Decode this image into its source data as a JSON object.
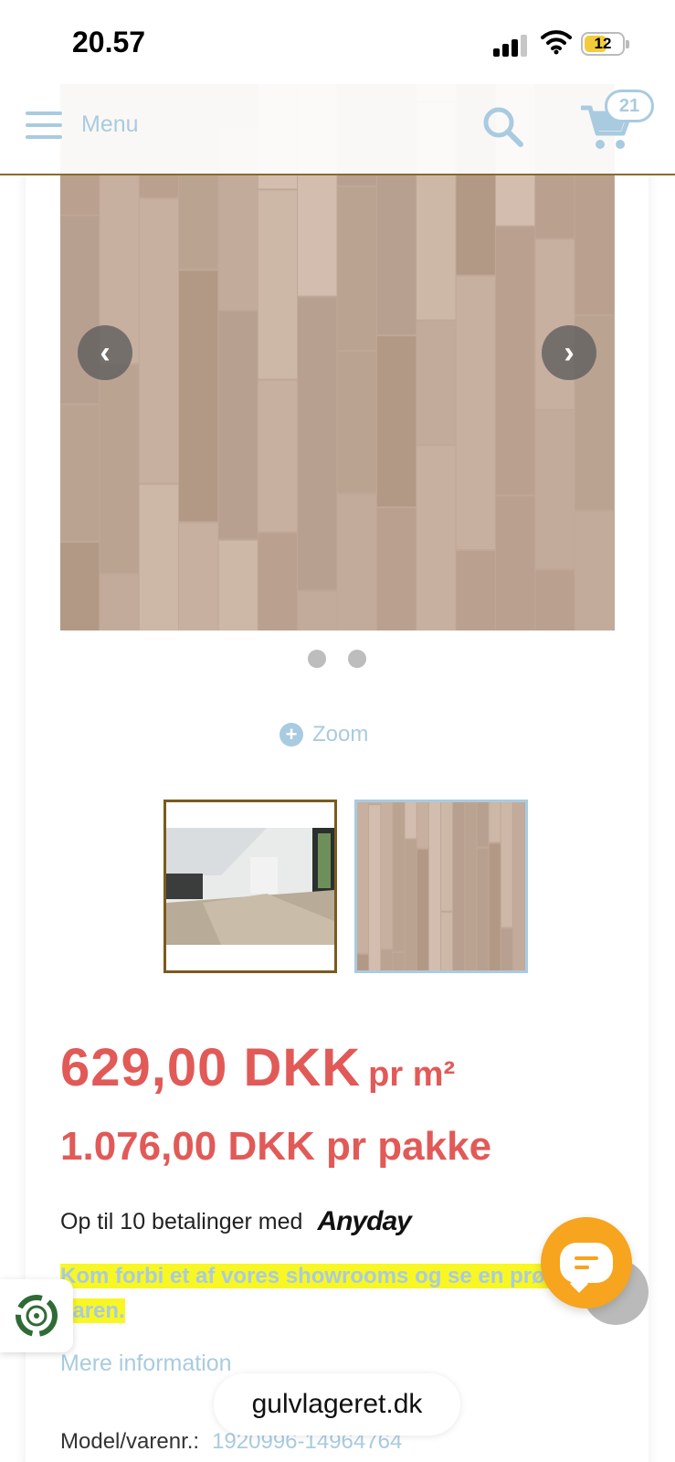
{
  "status_bar": {
    "time": "20.57",
    "battery": "12"
  },
  "header": {
    "menu_label": "Menu",
    "cart_count": "21"
  },
  "gallery": {
    "zoom_label": "Zoom",
    "slide_count": 2
  },
  "pricing": {
    "price_per_m2": "629,00 DKK",
    "unit_m2": "pr m²",
    "price_per_package": "1.076,00 DKK pr pakke"
  },
  "payment": {
    "text": "Op til 10 betalinger med",
    "provider": "Anyday"
  },
  "showroom_notice": "Kom forbi et af vores showrooms og se en prøve på varen.",
  "more_info": "Mere information",
  "model": {
    "label": "Model/varenr.:",
    "value": "1920996-14964764"
  },
  "browser": {
    "url": "gulvlageret.dk"
  },
  "colors": {
    "accent_blue": "#a9cbe0",
    "price_red": "#e15a57",
    "chat_orange": "#f7a41e",
    "highlight_yellow": "#f8f724"
  }
}
